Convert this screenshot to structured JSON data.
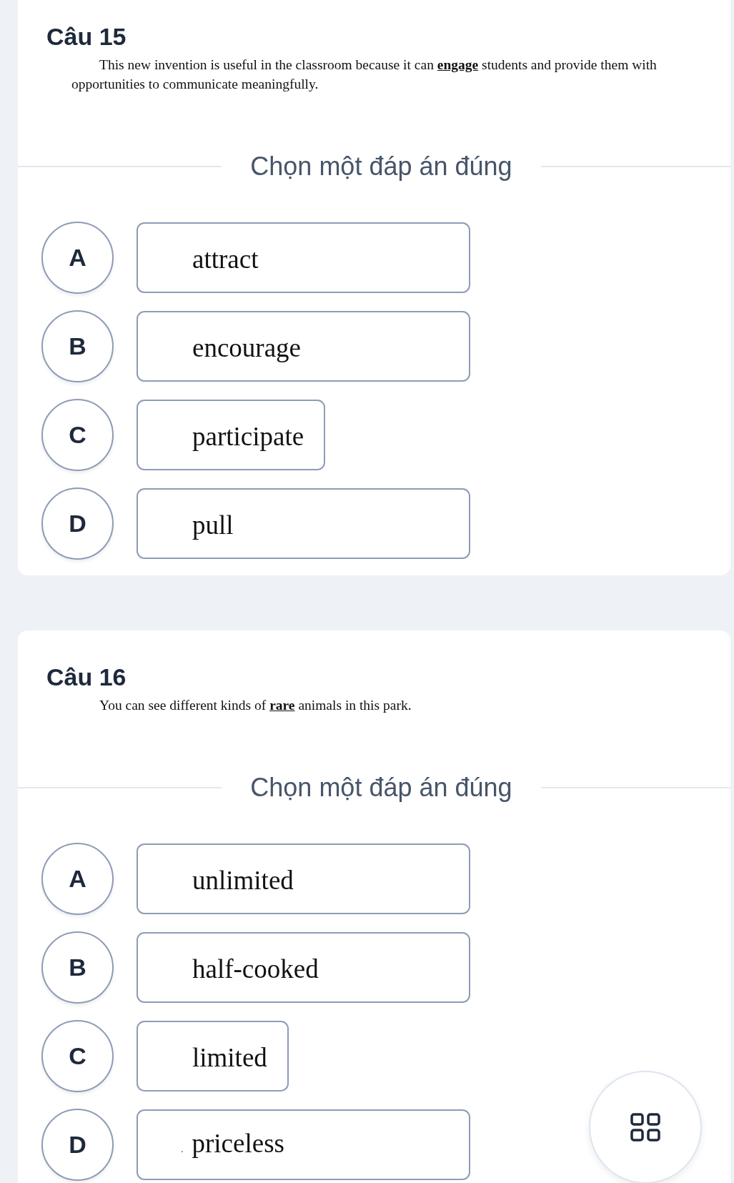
{
  "questions": [
    {
      "title": "Câu 15",
      "text": "This new invention is useful in the classroom because it can **engage** students and provide them with opportunities to communicate meaningfully.",
      "prompt": "Chọn một đáp án đúng",
      "options": [
        {
          "letter": "A",
          "text": "attract",
          "kind": "wide",
          "selected": false
        },
        {
          "letter": "B",
          "text": "encourage",
          "kind": "wide",
          "selected": false
        },
        {
          "letter": "C",
          "text": "participate",
          "kind": "fit",
          "selected": false
        },
        {
          "letter": "D",
          "text": "pull",
          "kind": "wide",
          "selected": false
        }
      ]
    },
    {
      "title": "Câu 16",
      "text": "You can see different kinds of **rare** animals in this park.",
      "prompt": "Chọn một đáp án đúng",
      "options": [
        {
          "letter": "A",
          "text": "unlimited",
          "kind": "wide",
          "selected": false
        },
        {
          "letter": "B",
          "text": "half-cooked",
          "kind": "wide",
          "selected": false
        },
        {
          "letter": "C",
          "text": "limited",
          "kind": "fit",
          "selected": false
        },
        {
          "letter": "D",
          "prefix": ".",
          "text": "priceless",
          "kind": "wide",
          "selected": false
        }
      ]
    }
  ]
}
